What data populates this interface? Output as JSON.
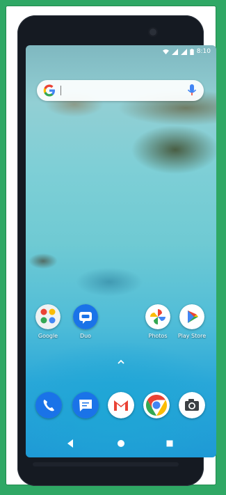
{
  "statusbar": {
    "time": "8:10"
  },
  "search": {
    "placeholder": ""
  },
  "home_apps": [
    {
      "label": "Google"
    },
    {
      "label": "Duo"
    },
    {
      "label": "Photos"
    },
    {
      "label": "Play Store"
    }
  ],
  "dock_apps": [
    "phone-icon",
    "messages-icon",
    "gmail-icon",
    "chrome-icon",
    "camera-icon"
  ],
  "colors": {
    "frame": "#2fa865",
    "phone_body": "#151a22",
    "duo": "#1a73e8"
  }
}
